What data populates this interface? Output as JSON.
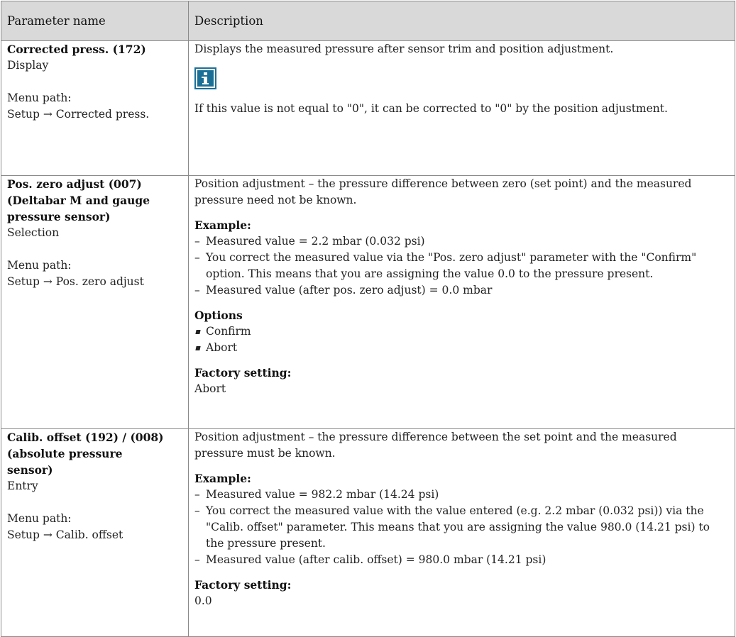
{
  "header": {
    "col1": "Parameter name",
    "col2": "Description"
  },
  "rows": [
    {
      "name_lines": [
        "Corrected press. (172)"
      ],
      "type": "Display",
      "menu_label": "Menu path:",
      "menu_path": "Setup → Corrected press.",
      "desc": "Displays the measured pressure after sensor trim and position adjustment.",
      "info_icon": "info-icon",
      "note": "If this value is not equal to \"0\", it can be corrected to \"0\" by the position adjustment."
    },
    {
      "name_lines": [
        "Pos. zero adjust (007)",
        "(Deltabar M and gauge",
        "pressure sensor)"
      ],
      "type": "Selection",
      "menu_label": "Menu path:",
      "menu_path": "Setup → Pos. zero adjust",
      "desc": "Position adjustment – the pressure difference between zero (set point) and the measured pressure need not be known.",
      "example_label": "Example:",
      "example_items": [
        "Measured value = 2.2 mbar (0.032 psi)",
        "You correct the measured value via the \"Pos. zero adjust\" parameter with the \"Confirm\" option. This means that you are assigning the value 0.0 to the pressure present.",
        "Measured value (after pos. zero adjust) = 0.0 mbar"
      ],
      "options_label": "Options",
      "options": [
        "Confirm",
        "Abort"
      ],
      "factory_label": "Factory setting:",
      "factory_value": "Abort"
    },
    {
      "name_lines": [
        "Calib. offset (192) / (008)",
        "(absolute pressure",
        "sensor)"
      ],
      "type": "Entry",
      "menu_label": "Menu path:",
      "menu_path": "Setup → Calib. offset",
      "desc": "Position adjustment – the pressure difference between the set point and the measured pressure must be known.",
      "example_label": "Example:",
      "example_items": [
        "Measured value = 982.2 mbar (14.24 psi)",
        "You correct the measured value with the value entered (e.g. 2.2 mbar (0.032 psi)) via the \"Calib. offset\" parameter. This means that you are assigning the value 980.0 (14.21 psi) to the pressure present.",
        "Measured value (after calib. offset) = 980.0 mbar (14.21 psi)"
      ],
      "factory_label": "Factory setting:",
      "factory_value": "0.0"
    }
  ]
}
